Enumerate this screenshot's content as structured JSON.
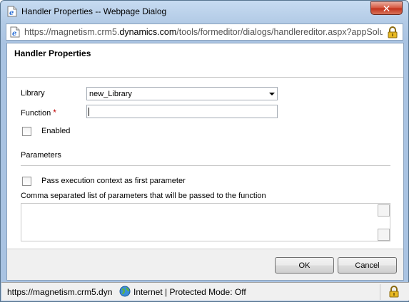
{
  "window": {
    "title": "Handler Properties -- Webpage Dialog",
    "close_label": "✕"
  },
  "address": {
    "url_prefix": "https://magnetism.crm5.",
    "url_domain": "dynamics.com",
    "url_suffix": "/tools/formeditor/dialogs/handlereditor.aspx?appSolu"
  },
  "dialog": {
    "header_title": "Handler Properties",
    "library_label": "Library",
    "library_value": "new_Library",
    "function_label": "Function",
    "required_marker": "*",
    "function_value": "",
    "enabled_label": "Enabled",
    "parameters_heading": "Parameters",
    "pass_context_label": "Pass execution context as first parameter",
    "params_list_label": "Comma separated list of parameters that will be passed to the function",
    "params_value": ""
  },
  "footer": {
    "ok_label": "OK",
    "cancel_label": "Cancel"
  },
  "statusbar": {
    "url": "https://magnetism.crm5.dyn",
    "zone": "Internet | Protected Mode: Off"
  },
  "colors": {
    "required": "#c00000",
    "title_gradient_top": "#c7dbf1",
    "close_red": "#c1301a"
  },
  "icons": {
    "title": "ie-page-icon",
    "address": "ie-page-icon",
    "address_lock": "padlock-icon",
    "zone": "globe-icon",
    "status_lock": "padlock-icon"
  }
}
